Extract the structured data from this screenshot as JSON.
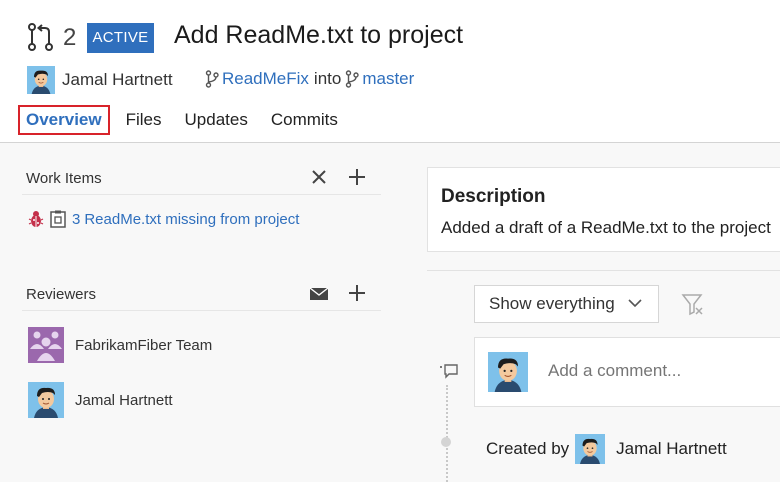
{
  "header": {
    "pr_icon": "pull-request-icon",
    "pr_id": "2",
    "status": "ACTIVE",
    "title": "Add ReadMe.txt to project",
    "author": "Jamal Hartnett",
    "source_branch": "ReadMeFix",
    "into_text": "into",
    "target_branch": "master"
  },
  "tabs": [
    {
      "label": "Overview",
      "active": true
    },
    {
      "label": "Files"
    },
    {
      "label": "Updates"
    },
    {
      "label": "Commits"
    }
  ],
  "work_items": {
    "title": "Work Items",
    "item": {
      "id": "3",
      "text": "ReadMe.txt missing from project"
    }
  },
  "reviewers": {
    "title": "Reviewers",
    "items": [
      {
        "name": "FabrikamFiber Team",
        "type": "team"
      },
      {
        "name": "Jamal Hartnett",
        "type": "user"
      }
    ]
  },
  "description": {
    "title": "Description",
    "text": "Added a draft of a ReadMe.txt to the project"
  },
  "activity": {
    "filter_value": "Show everything",
    "comment_placeholder": "Add a comment...",
    "created_by_label": "Created by",
    "created_by_name": "Jamal Hartnett"
  },
  "colors": {
    "accent": "#2f6fbd",
    "active_tab_outline": "#d8232a",
    "team_avatar": "#9b68ad",
    "bug_icon": "#c4314b"
  }
}
